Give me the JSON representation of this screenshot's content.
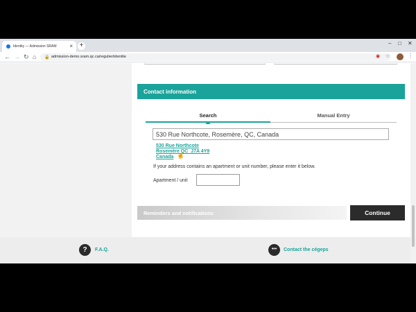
{
  "browser": {
    "tab_title": "Identity — Admission SRAM",
    "close_glyph": "×",
    "new_tab_glyph": "+",
    "url": "admission-demo.sram.qc.ca/regulier/identite"
  },
  "contact": {
    "section_title": "Contact information",
    "tabs": [
      "Search",
      "Manual Entry"
    ],
    "address_value": "530 Rue Northcote, Rosemère, QC, Canada",
    "suggestion": {
      "line1": "530 Rue Northcote",
      "line2": "Rosemère QC  J7A 4Y9",
      "line3": "Canada"
    },
    "hint": "If your address contains an apartment or unit number, please enter it below.",
    "apartment_label": "Apartment / unit",
    "apartment_value": ""
  },
  "reminders": {
    "title": "Reminders and notifications"
  },
  "actions": {
    "continue_label": "Continue"
  },
  "footer": {
    "faq_label": "F.A.Q.",
    "faq_icon_glyph": "?",
    "cegeps_label": "Contact the cégeps",
    "cegeps_icon_glyph": "•••"
  },
  "icons": {
    "faq": "question-icon",
    "cegeps": "chat-bubble-icon"
  },
  "colors": {
    "accent": "#1aa39a",
    "dark_button": "#2b2b2b"
  }
}
